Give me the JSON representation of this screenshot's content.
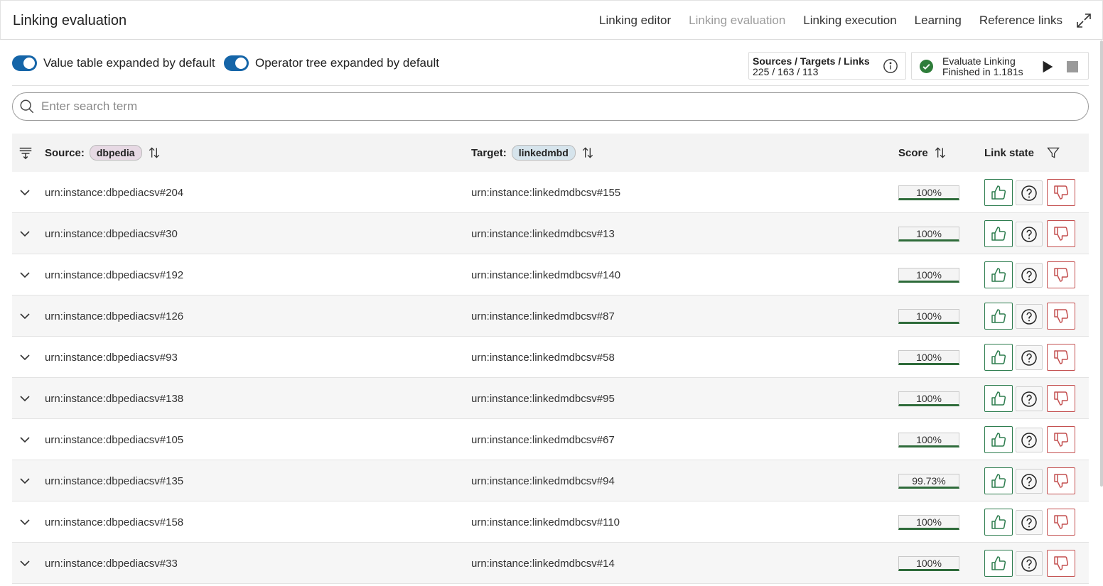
{
  "header": {
    "title": "Linking evaluation",
    "tabs": [
      {
        "label": "Linking editor",
        "active": false
      },
      {
        "label": "Linking evaluation",
        "active": true
      },
      {
        "label": "Linking execution",
        "active": false
      },
      {
        "label": "Learning",
        "active": false
      },
      {
        "label": "Reference links",
        "active": false
      }
    ]
  },
  "toolbar": {
    "toggle_value_table": {
      "label": "Value table expanded by default",
      "on": true
    },
    "toggle_operator_tree": {
      "label": "Operator tree expanded by default",
      "on": true
    },
    "stats": {
      "label": "Sources / Targets / Links",
      "value": "225 / 163 / 113"
    },
    "evaluation": {
      "title": "Evaluate Linking",
      "status": "Finished in 1.181s"
    }
  },
  "search": {
    "placeholder": "Enter search term",
    "value": ""
  },
  "table": {
    "source_label": "Source:",
    "source_tag": "dbpedia",
    "target_label": "Target:",
    "target_tag": "linkedmbd",
    "score_label": "Score",
    "link_state_label": "Link state",
    "rows": [
      {
        "source": "urn:instance:dbpediacsv#204",
        "target": "urn:instance:linkedmdbcsv#155",
        "score": "100%"
      },
      {
        "source": "urn:instance:dbpediacsv#30",
        "target": "urn:instance:linkedmdbcsv#13",
        "score": "100%"
      },
      {
        "source": "urn:instance:dbpediacsv#192",
        "target": "urn:instance:linkedmdbcsv#140",
        "score": "100%"
      },
      {
        "source": "urn:instance:dbpediacsv#126",
        "target": "urn:instance:linkedmdbcsv#87",
        "score": "100%"
      },
      {
        "source": "urn:instance:dbpediacsv#93",
        "target": "urn:instance:linkedmdbcsv#58",
        "score": "100%"
      },
      {
        "source": "urn:instance:dbpediacsv#138",
        "target": "urn:instance:linkedmdbcsv#95",
        "score": "100%"
      },
      {
        "source": "urn:instance:dbpediacsv#105",
        "target": "urn:instance:linkedmdbcsv#67",
        "score": "100%"
      },
      {
        "source": "urn:instance:dbpediacsv#135",
        "target": "urn:instance:linkedmdbcsv#94",
        "score": "99.73%"
      },
      {
        "source": "urn:instance:dbpediacsv#158",
        "target": "urn:instance:linkedmdbcsv#110",
        "score": "100%"
      },
      {
        "source": "urn:instance:dbpediacsv#33",
        "target": "urn:instance:linkedmdbcsv#14",
        "score": "100%"
      }
    ]
  },
  "colors": {
    "toggle_on": "#1565a8",
    "positive": "#2e7d4f",
    "negative": "#c45050",
    "score_bar": "#2e6b3a",
    "success_icon": "#2e7d3a"
  },
  "icons": {
    "expand": "fullscreen-expand-icon",
    "info": "info-circle-icon",
    "success": "check-circle-icon",
    "play": "play-icon",
    "stop": "stop-icon",
    "search": "search-icon",
    "column_config": "column-config-icon",
    "sort": "sort-arrows-icon",
    "filter": "filter-funnel-icon",
    "row_expand": "chevron-down-icon",
    "confirm": "thumbs-up-icon",
    "uncertain": "question-circle-icon",
    "decline": "thumbs-down-icon"
  }
}
